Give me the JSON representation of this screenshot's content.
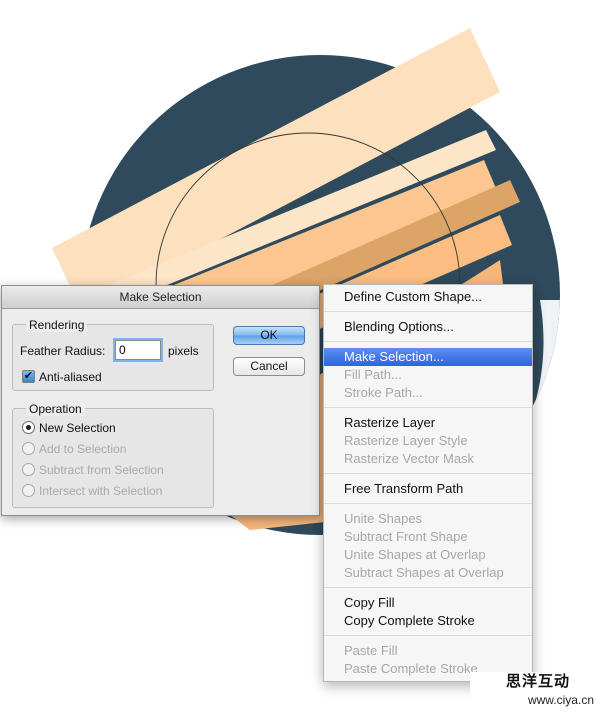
{
  "colors": {
    "circle": "#2e4a5c",
    "stripe_light": "#fde0bd",
    "stripe_mid": "#fcc690",
    "stripe_dark": "#dca467",
    "menu_highlight": "#2e63e0"
  },
  "dialog": {
    "title": "Make Selection",
    "rendering": {
      "label": "Rendering",
      "feather_label": "Feather Radius:",
      "feather_value": "0",
      "feather_unit": "pixels",
      "anti_aliased_label": "Anti-aliased",
      "anti_aliased_checked": true
    },
    "operation": {
      "label": "Operation",
      "options": [
        {
          "label": "New Selection",
          "selected": true,
          "enabled": true
        },
        {
          "label": "Add to Selection",
          "selected": false,
          "enabled": false
        },
        {
          "label": "Subtract from Selection",
          "selected": false,
          "enabled": false
        },
        {
          "label": "Intersect with Selection",
          "selected": false,
          "enabled": false
        }
      ]
    },
    "ok_label": "OK",
    "cancel_label": "Cancel"
  },
  "menu": {
    "items": [
      {
        "label": "Define Custom Shape...",
        "enabled": true
      },
      {
        "label": "Blending Options...",
        "enabled": true
      },
      {
        "label": "Make Selection...",
        "enabled": true,
        "highlighted": true
      },
      {
        "label": "Fill Path...",
        "enabled": false
      },
      {
        "label": "Stroke Path...",
        "enabled": false
      },
      {
        "label": "Rasterize Layer",
        "enabled": true
      },
      {
        "label": "Rasterize Layer Style",
        "enabled": false
      },
      {
        "label": "Rasterize Vector Mask",
        "enabled": false
      },
      {
        "label": "Free Transform Path",
        "enabled": true
      },
      {
        "label": "Unite Shapes",
        "enabled": false
      },
      {
        "label": "Subtract Front Shape",
        "enabled": false
      },
      {
        "label": "Unite Shapes at Overlap",
        "enabled": false
      },
      {
        "label": "Subtract Shapes at Overlap",
        "enabled": false
      },
      {
        "label": "Copy Fill",
        "enabled": true
      },
      {
        "label": "Copy Complete Stroke",
        "enabled": true
      },
      {
        "label": "Paste Fill",
        "enabled": false
      },
      {
        "label": "Paste Complete Stroke",
        "enabled": false
      }
    ]
  },
  "watermark": {
    "chinese": "思洋互动",
    "url": "www.ciya.cn"
  }
}
